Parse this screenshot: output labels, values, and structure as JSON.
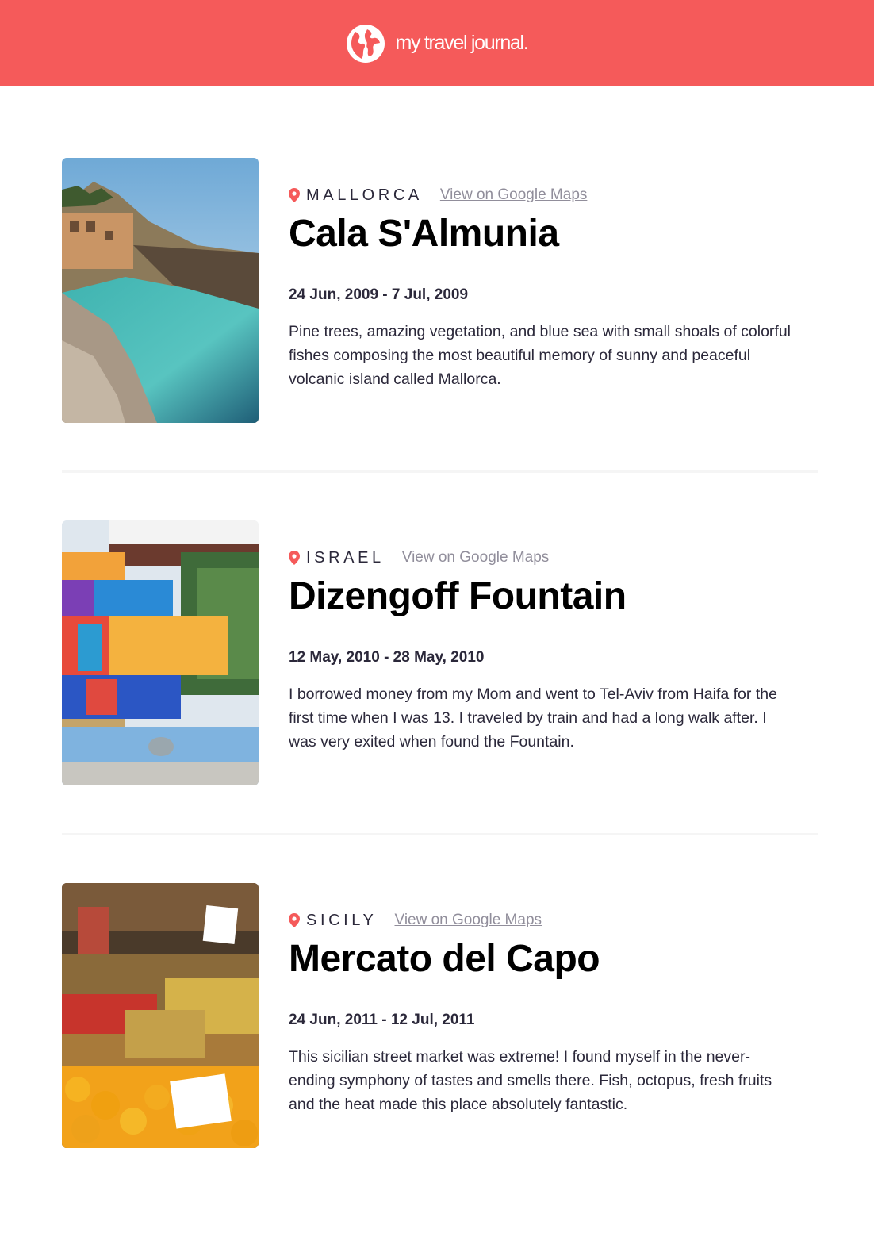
{
  "header": {
    "brand": "my travel journal.",
    "icon": "globe-icon",
    "background": "#f55a5a"
  },
  "entries": [
    {
      "location": "Mallorca",
      "maps_link": "View on Google Maps",
      "title": "Cala S'Almunia",
      "dates": "24 Jun, 2009 - 7 Jul, 2009",
      "description": "Pine trees, amazing vegetation, and blue sea with small shoals of colorful fishes composing the most beautiful memory of sunny and peaceful volcanic island called Mallorca."
    },
    {
      "location": "Israel",
      "maps_link": "View on Google Maps",
      "title": "Dizengoff Fountain",
      "dates": "12 May, 2010 - 28 May, 2010",
      "description": "I borrowed money from my Mom and went to Tel-Aviv from Haifa for the first time when I was 13. I traveled by train and had a long walk after. I was very exited when found the Fountain."
    },
    {
      "location": "Sicily",
      "maps_link": "View on Google Maps",
      "title": "Mercato del Capo",
      "dates": "24 Jun, 2011 - 12 Jul, 2011",
      "description": "This sicilian street market was extreme! I found myself in the never-ending symphony of tastes and smells there. Fish, octopus, fresh fruits and the heat made this place absolutely fantastic."
    }
  ],
  "colors": {
    "accent": "#f55a5a",
    "link": "#918e9b",
    "text": "#2b283a"
  }
}
